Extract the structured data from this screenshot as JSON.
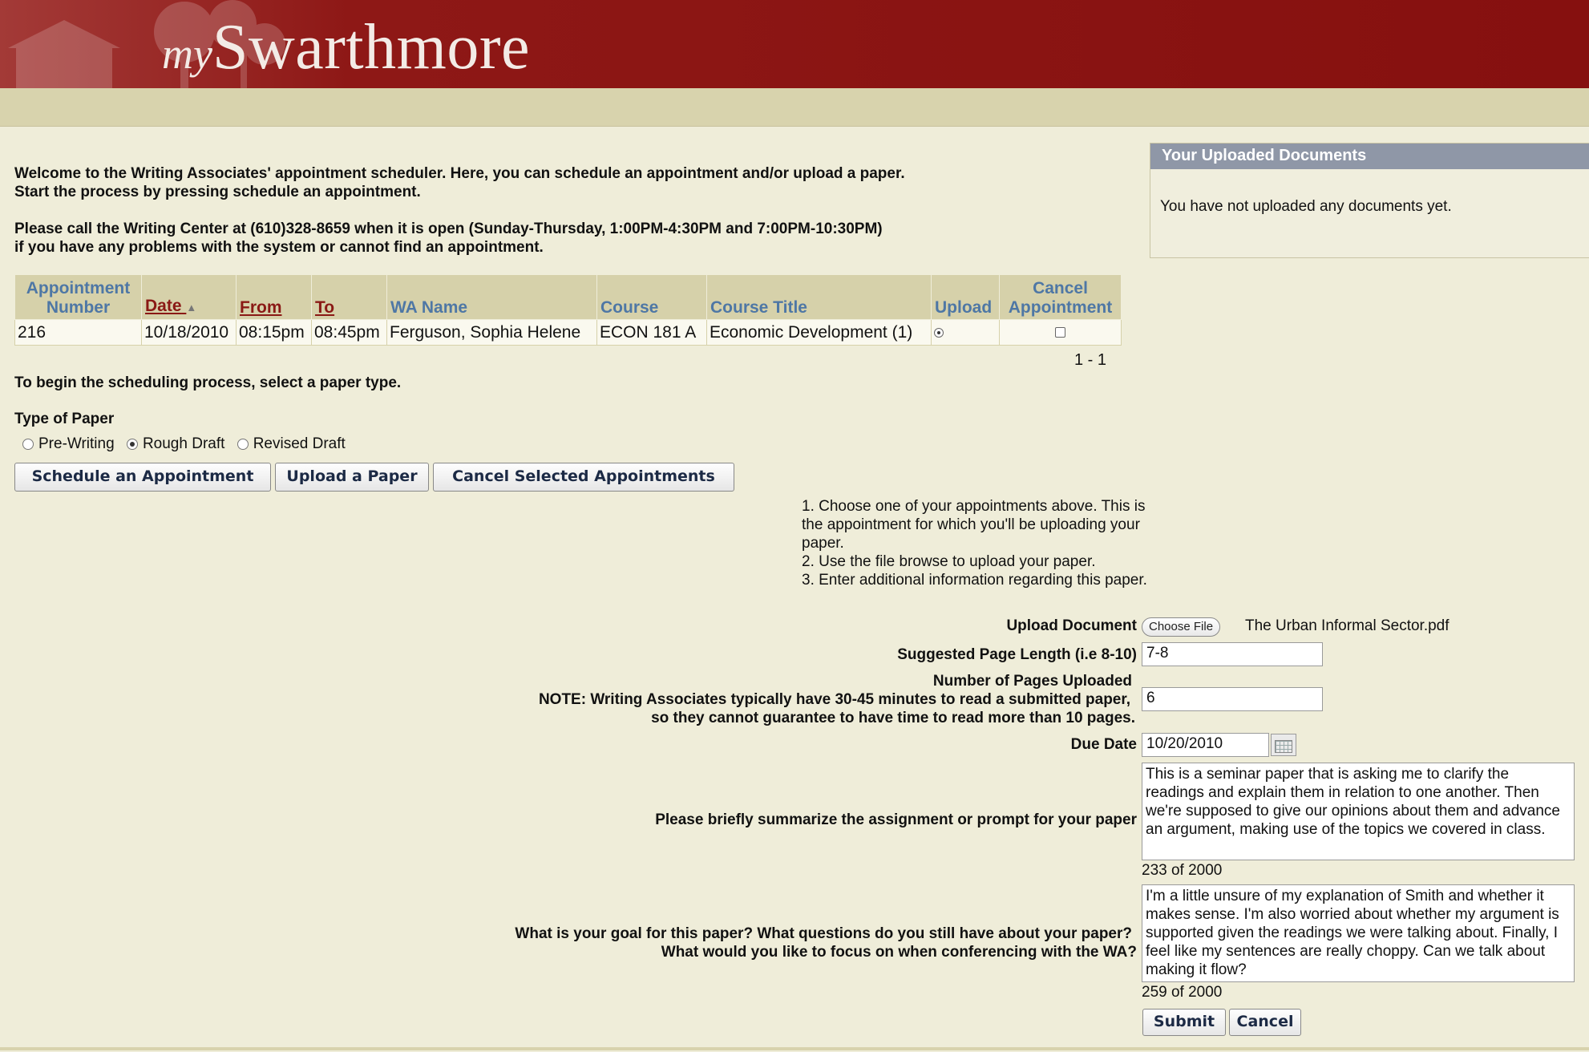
{
  "header": {
    "logo_prefix": "my",
    "logo_main": "Swarthmore"
  },
  "intro": {
    "line1": "Welcome to the Writing Associates' appointment scheduler. Here, you can schedule an appointment and/or upload a paper.",
    "line2": "Start the process by pressing schedule an appointment.",
    "line3": "Please call the Writing Center at (610)328-8659 when it is open (Sunday-Thursday, 1:00PM-4:30PM and 7:00PM-10:30PM)",
    "line4": "if you have any problems with the system or cannot find an appointment."
  },
  "sidebar": {
    "title": "Your Uploaded Documents",
    "empty_text": "You have not uploaded any documents yet."
  },
  "table": {
    "headers": {
      "number_line1": "Appointment",
      "number_line2": "Number",
      "date": "Date",
      "from": "From",
      "to": "To",
      "wa_name": "WA Name",
      "course": "Course",
      "course_title": "Course Title",
      "upload": "Upload",
      "cancel_line1": "Cancel",
      "cancel_line2": "Appointment"
    },
    "rows": [
      {
        "number": "216",
        "date": "10/18/2010",
        "from": "08:15pm",
        "to": "08:45pm",
        "wa_name": "Ferguson, Sophia Helene",
        "course": "ECON 181 A",
        "course_title": "Economic Development (1)"
      }
    ],
    "pagination": "1 - 1"
  },
  "paper": {
    "prompt": "To begin the scheduling process, select a paper type.",
    "type_label": "Type of Paper",
    "options": [
      "Pre-Writing",
      "Rough Draft",
      "Revised Draft"
    ],
    "selected": "Rough Draft"
  },
  "buttons": {
    "schedule": "Schedule an Appointment",
    "upload": "Upload a Paper",
    "cancel_selected": "Cancel Selected Appointments"
  },
  "instructions": {
    "l1": "1.  Choose one of your appointments above. This is",
    "l2": "the appointment for which you'll be uploading your",
    "l3": "paper.",
    "l4": "2.  Use the file browse to upload your paper.",
    "l5": "3.  Enter additional information regarding this paper."
  },
  "form": {
    "upload_label": "Upload Document",
    "choose_file": "Choose File",
    "file_name": "The Urban Informal Sector.pdf",
    "page_length_label": "Suggested Page Length (i.e 8-10)",
    "page_length_value": "7-8",
    "pages_label_1": "Number of Pages Uploaded",
    "pages_label_2": "NOTE: Writing Associates typically have 30-45 minutes to read a submitted paper,",
    "pages_label_3": "so they cannot guarantee to have time to read more than 10 pages.",
    "pages_value": "6",
    "due_label": "Due Date",
    "due_value": "10/20/2010",
    "summary_label": "Please briefly summarize the assignment or prompt for your paper",
    "summary_value": "This is a seminar paper that is asking me to clarify the readings and explain them in relation to one another. Then we're supposed to give our opinions about them and advance an argument, making use of the topics we covered in class.",
    "summary_count": "233 of 2000",
    "goal_label_1": "What is your goal for this paper? What questions do you still have about your paper?",
    "goal_label_2": "What would you like to focus on when conferencing with the WA?",
    "goal_value": "I'm a little unsure of my explanation of Smith and whether it makes sense. I'm also worried about whether my argument is supported given the readings we were talking about. Finally, I feel like my sentences are really choppy. Can we talk about making it flow?",
    "goal_count": "259 of 2000",
    "submit": "Submit",
    "cancel": "Cancel"
  }
}
